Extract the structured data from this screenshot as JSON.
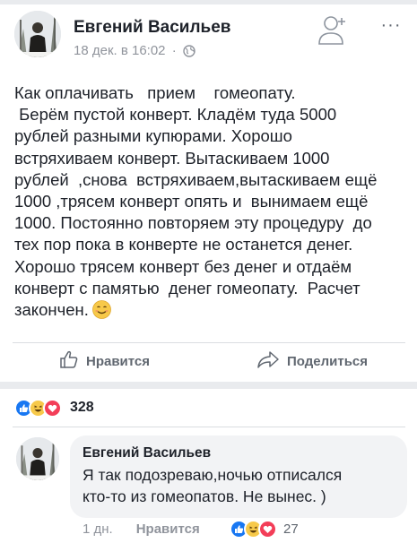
{
  "post": {
    "author": "Евгений Васильев",
    "timestamp": "18 дек. в 16:02",
    "separator": "·",
    "privacy_icon": "globe-icon",
    "follow_icon": "add-friend-icon",
    "more_label": "···",
    "text": "Как оплачивать   прием    гомеопату.\n Берём пустой конверт. Кладём туда 5000\nрублей разными купюрами. Хорошо\nвстряхиваем конверт. Вытаскиваем 1000\nрублей  ,снова  встряхиваем,вытаскиваем ещё\n1000 ,трясем конверт опять и  вынимаем ещё\n1000. Постоянно повторяем эту процедуру  до\nтех пор пока в конверте не останется денег.\nХорошо трясем конверт без денег и отдаём\nконверт с памятью  денег гомеопату.  Расчет\nзакончен.",
    "emoji": "smiling-face-icon"
  },
  "actions": {
    "like_label": "Нравится",
    "share_label": "Поделиться"
  },
  "reactions": {
    "types": [
      "like-icon",
      "haha-icon",
      "love-icon"
    ],
    "count": "328"
  },
  "comment": {
    "author": "Евгений Васильев",
    "text": "Я так подозреваю,ночью отписался\nкто-то из гомеопатов. Не вынес. )",
    "age": "1 дн.",
    "like_label": "Нравится",
    "reactions": [
      "like-icon",
      "haha-icon",
      "love-icon"
    ],
    "reaction_count": "27"
  },
  "colors": {
    "accent": "#1877f2",
    "text": "#1d2129",
    "muted": "#90949c",
    "bubble": "#f2f3f5",
    "divider": "#e9ebee"
  }
}
